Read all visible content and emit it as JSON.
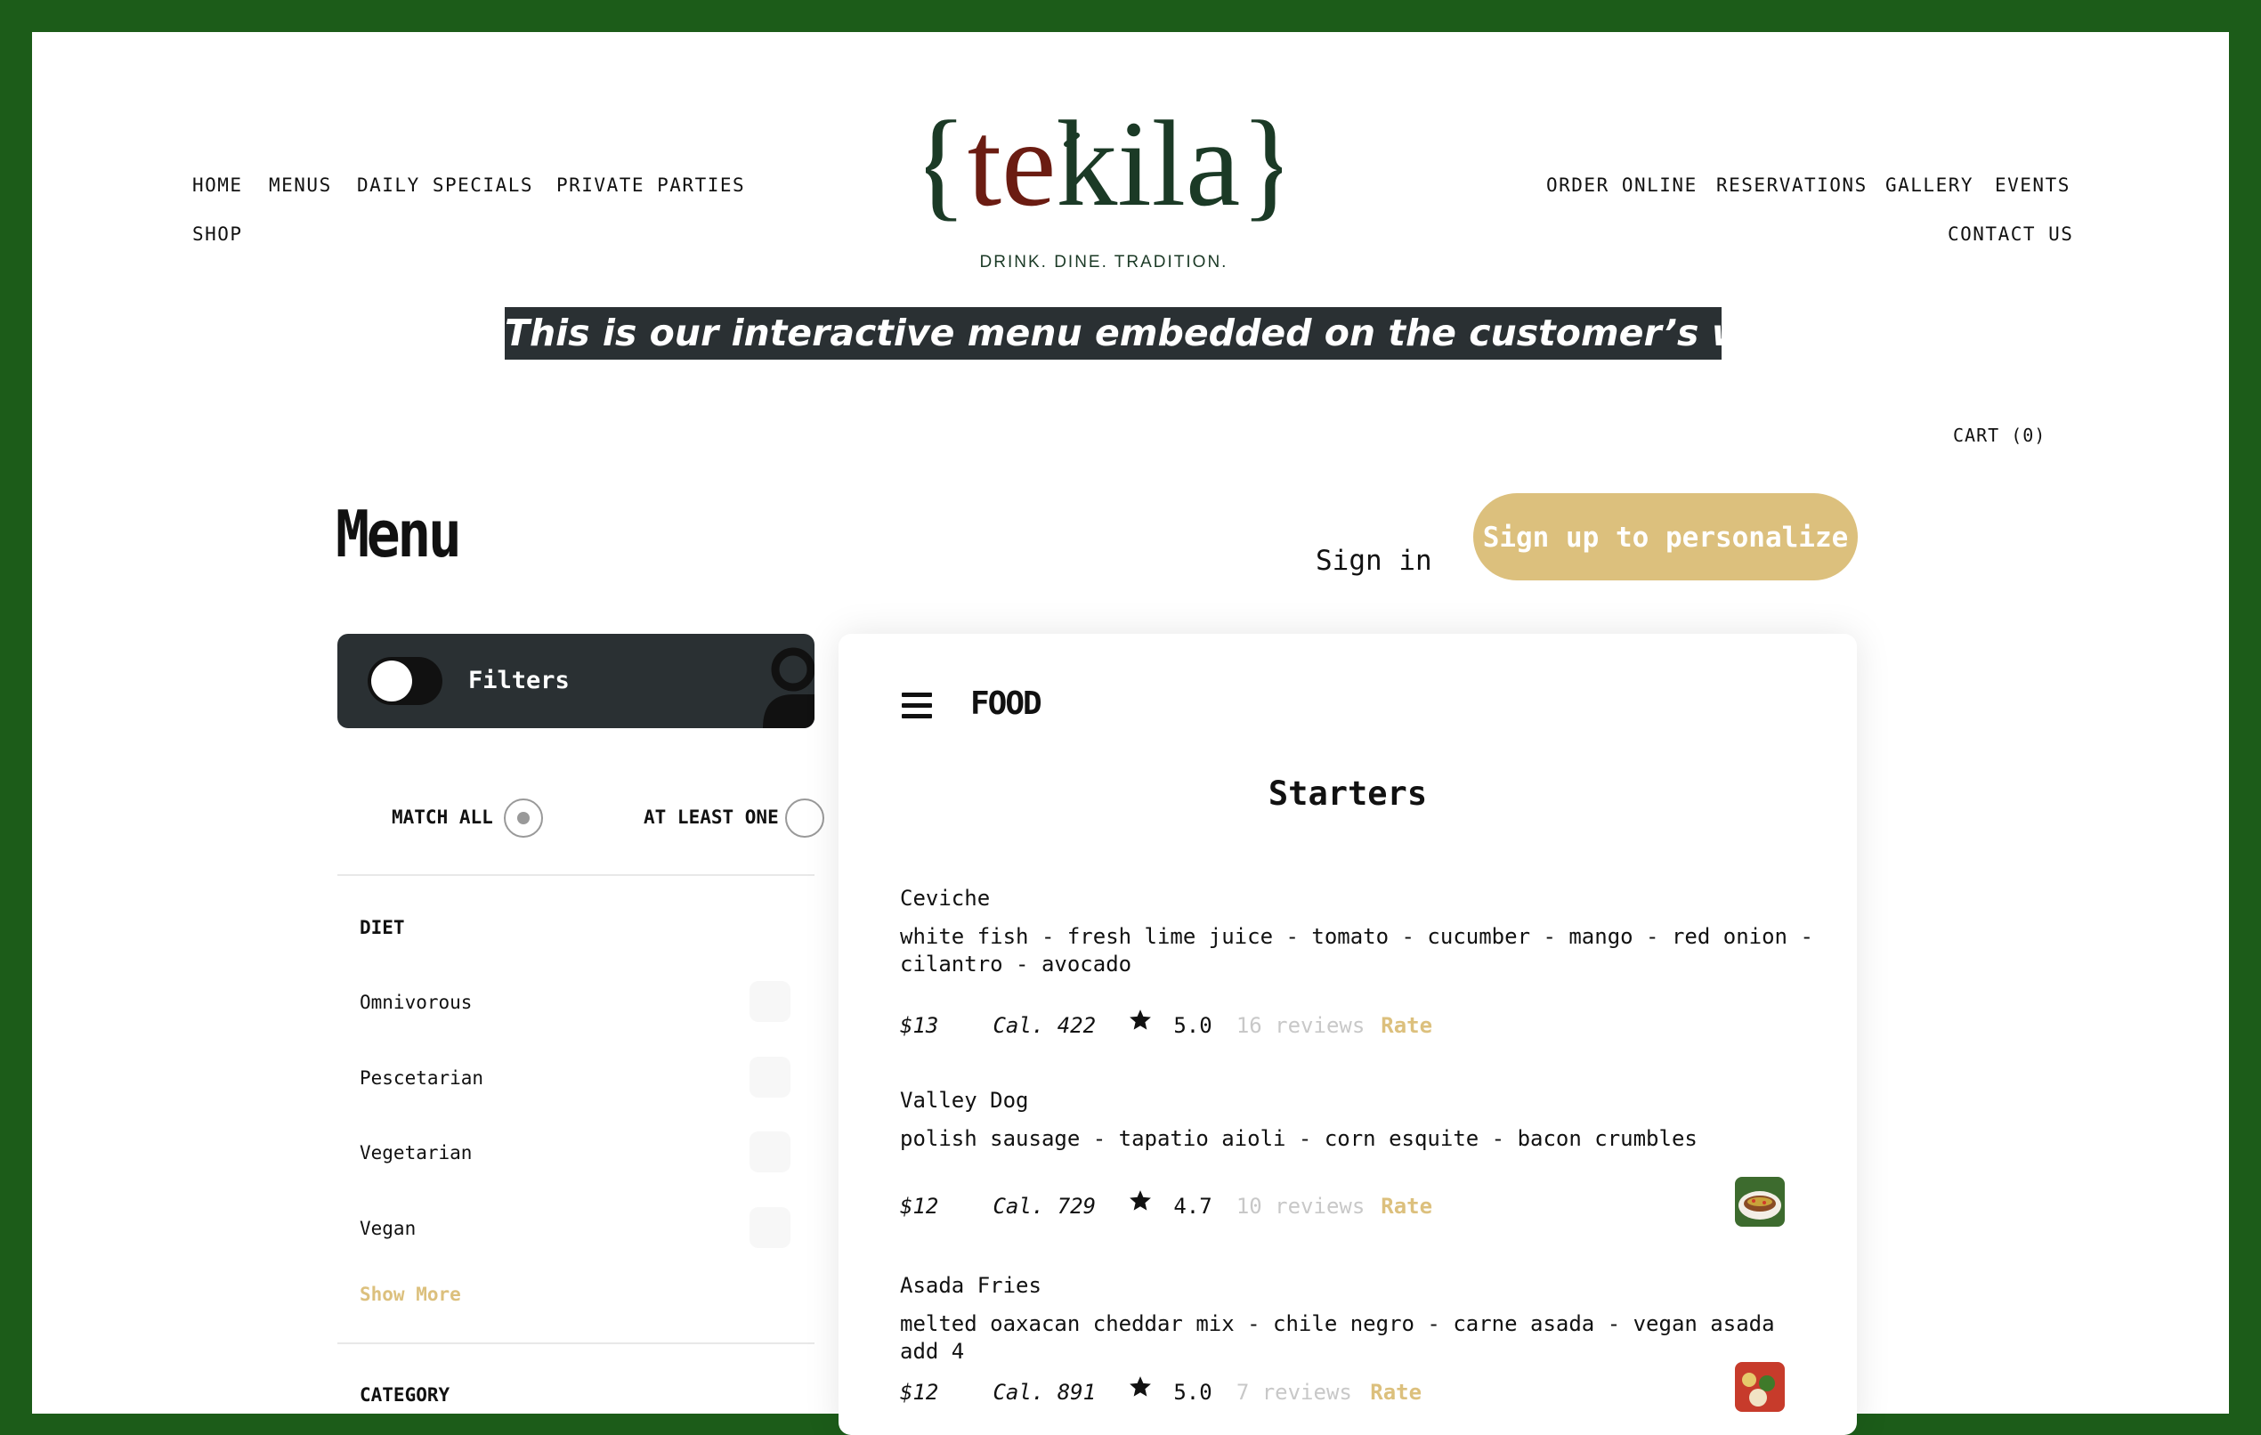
{
  "nav": {
    "left": [
      "HOME",
      "MENUS",
      "DAILY SPECIALS",
      "PRIVATE PARTIES",
      "SHOP"
    ],
    "right": [
      "ORDER ONLINE",
      "RESERVATIONS",
      "GALLERY",
      "EVENTS",
      "CONTACT US"
    ]
  },
  "logo": {
    "wordmark": "{tekila}",
    "tagline": "DRINK. DINE. TRADITION."
  },
  "banner": "This is our interactive menu embedded on the customer’s website",
  "cart": "CART (0)",
  "menu_title": "Menu",
  "auth": {
    "sign_in": "Sign in",
    "sign_up": "Sign up to personalize"
  },
  "filters": {
    "label": "Filters",
    "match_all": "MATCH ALL",
    "at_least_one": "AT LEAST ONE",
    "diet_title": "DIET",
    "diet": [
      "Omnivorous",
      "Pescetarian",
      "Vegetarian",
      "Vegan"
    ],
    "show_more": "Show More",
    "category_title": "CATEGORY"
  },
  "panel": {
    "section": "FOOD",
    "heading": "Starters"
  },
  "items": [
    {
      "name": "Ceviche",
      "desc": "white fish - fresh lime juice - tomato - cucumber - mango - red onion - cilantro - avocado",
      "price": "$13",
      "cal": "Cal. 422",
      "rating": "5.0",
      "reviews": "16 reviews",
      "rate": "Rate"
    },
    {
      "name": "Valley Dog",
      "desc": "polish sausage - tapatio aioli - corn esquite - bacon crumbles",
      "price": "$12",
      "cal": "Cal. 729",
      "rating": "4.7",
      "reviews": "10 reviews",
      "rate": "Rate"
    },
    {
      "name": "Asada Fries",
      "desc": "melted oaxacan cheddar mix - chile negro - carne asada - vegan asada add 4",
      "price": "$12",
      "cal": "Cal. 891",
      "rating": "5.0",
      "reviews": "7 reviews",
      "rate": "Rate"
    }
  ],
  "colors": {
    "frame": "#1c5c19",
    "accent": "#dcc07d",
    "dark": "#2a3033",
    "logo_red": "#6b1c12",
    "logo_green": "#1b3a26"
  }
}
